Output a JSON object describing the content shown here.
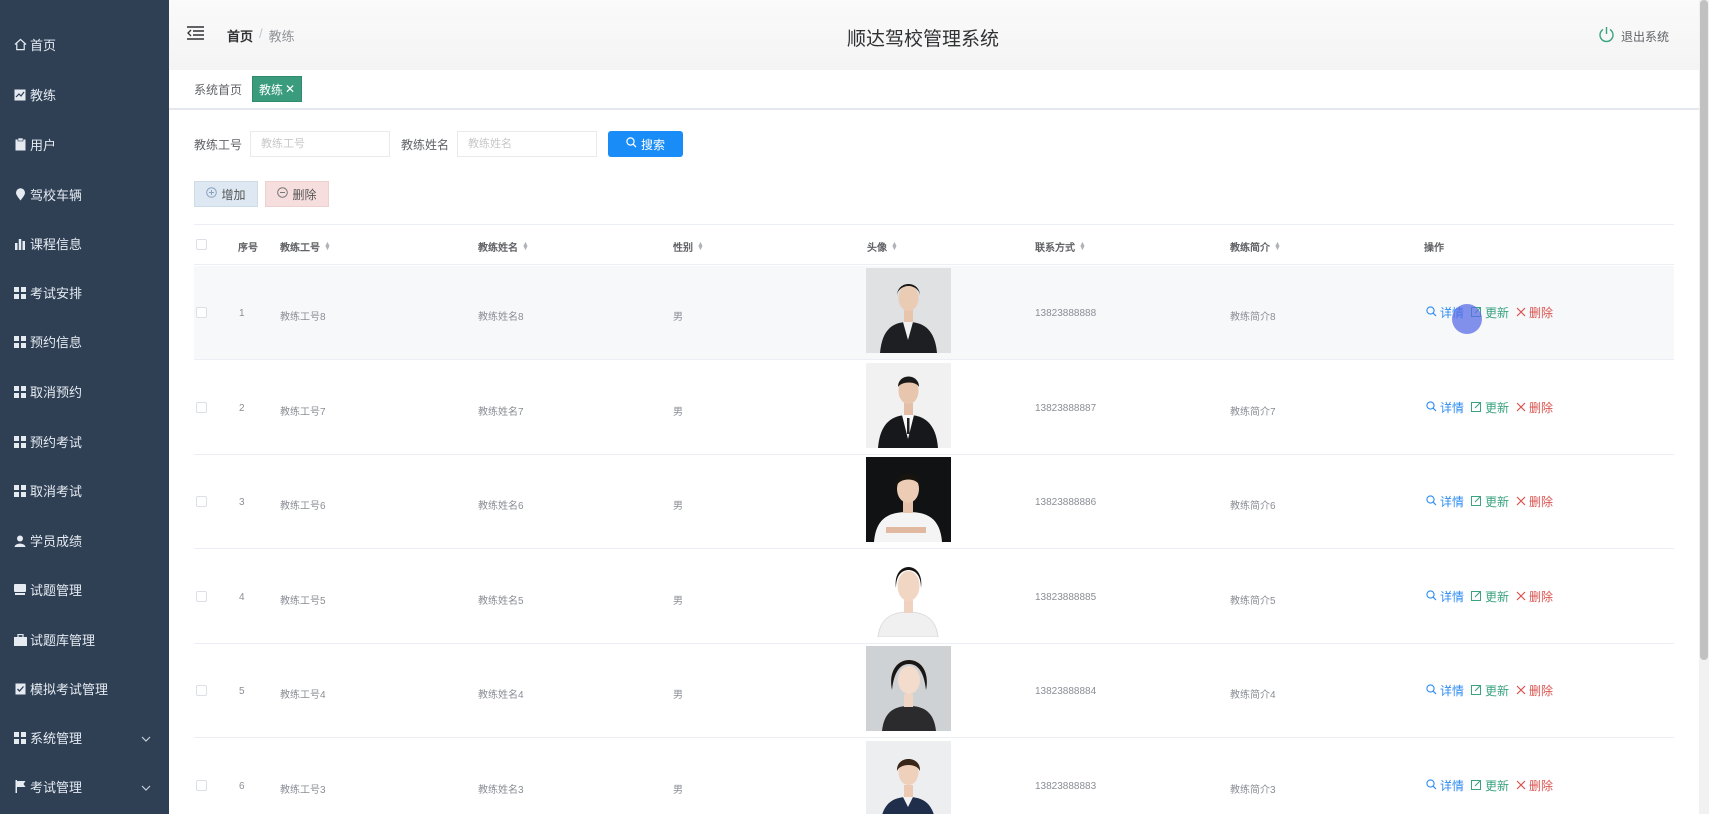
{
  "sidebar": {
    "items": [
      {
        "label": "首页",
        "icon": "home-icon"
      },
      {
        "label": "教练",
        "icon": "chart-icon"
      },
      {
        "label": "用户",
        "icon": "clipboard-icon"
      },
      {
        "label": "驾校车辆",
        "icon": "location-pin-icon"
      },
      {
        "label": "课程信息",
        "icon": "bar-chart-icon"
      },
      {
        "label": "考试安排",
        "icon": "grid-icon"
      },
      {
        "label": "预约信息",
        "icon": "grid-icon"
      },
      {
        "label": "取消预约",
        "icon": "grid-icon"
      },
      {
        "label": "预约考试",
        "icon": "grid-icon"
      },
      {
        "label": "取消考试",
        "icon": "grid-icon"
      },
      {
        "label": "学员成绩",
        "icon": "user-icon"
      },
      {
        "label": "试题管理",
        "icon": "card-icon"
      },
      {
        "label": "试题库管理",
        "icon": "briefcase-icon"
      },
      {
        "label": "模拟考试管理",
        "icon": "clipboard-check-icon"
      },
      {
        "label": "系统管理",
        "icon": "grid-icon"
      },
      {
        "label": "考试管理",
        "icon": "flag-icon"
      }
    ]
  },
  "header": {
    "breadcrumb_home": "首页",
    "breadcrumb_sep": "/",
    "breadcrumb_current": "教练",
    "title": "顺达驾校管理系统",
    "logout": "退出系统"
  },
  "tags": {
    "home": "系统首页",
    "active": "教练",
    "close": "✕"
  },
  "search": {
    "id_label": "教练工号",
    "id_placeholder": "教练工号",
    "name_label": "教练姓名",
    "name_placeholder": "教练姓名",
    "button": "搜索"
  },
  "actions": {
    "add": "增加",
    "delete": "删除"
  },
  "table": {
    "headers": {
      "index": "序号",
      "coach_id": "教练工号",
      "coach_name": "教练姓名",
      "gender": "性别",
      "avatar": "头像",
      "phone": "联系方式",
      "intro": "教练简介",
      "ops": "操作"
    },
    "op_labels": {
      "detail": "详情",
      "update": "更新",
      "delete": "删除"
    },
    "rows": [
      {
        "index": "1",
        "coach_id": "教练工号8",
        "coach_name": "教练姓名8",
        "gender": "男",
        "phone": "13823888888",
        "intro": "教练简介8"
      },
      {
        "index": "2",
        "coach_id": "教练工号7",
        "coach_name": "教练姓名7",
        "gender": "男",
        "phone": "13823888887",
        "intro": "教练简介7"
      },
      {
        "index": "3",
        "coach_id": "教练工号6",
        "coach_name": "教练姓名6",
        "gender": "男",
        "phone": "13823888886",
        "intro": "教练简介6"
      },
      {
        "index": "4",
        "coach_id": "教练工号5",
        "coach_name": "教练姓名5",
        "gender": "男",
        "phone": "13823888885",
        "intro": "教练简介5"
      },
      {
        "index": "5",
        "coach_id": "教练工号4",
        "coach_name": "教练姓名4",
        "gender": "男",
        "phone": "13823888884",
        "intro": "教练简介4"
      },
      {
        "index": "6",
        "coach_id": "教练工号3",
        "coach_name": "教练姓名3",
        "gender": "男",
        "phone": "13823888883",
        "intro": "教练简介3"
      }
    ]
  },
  "colors": {
    "sidebar_bg": "#2f4054",
    "tag_active": "#3a9c7c",
    "search_button": "#1a8cf7",
    "detail": "#2d8cf0",
    "update": "#3aa37f",
    "delete": "#d9534f"
  }
}
